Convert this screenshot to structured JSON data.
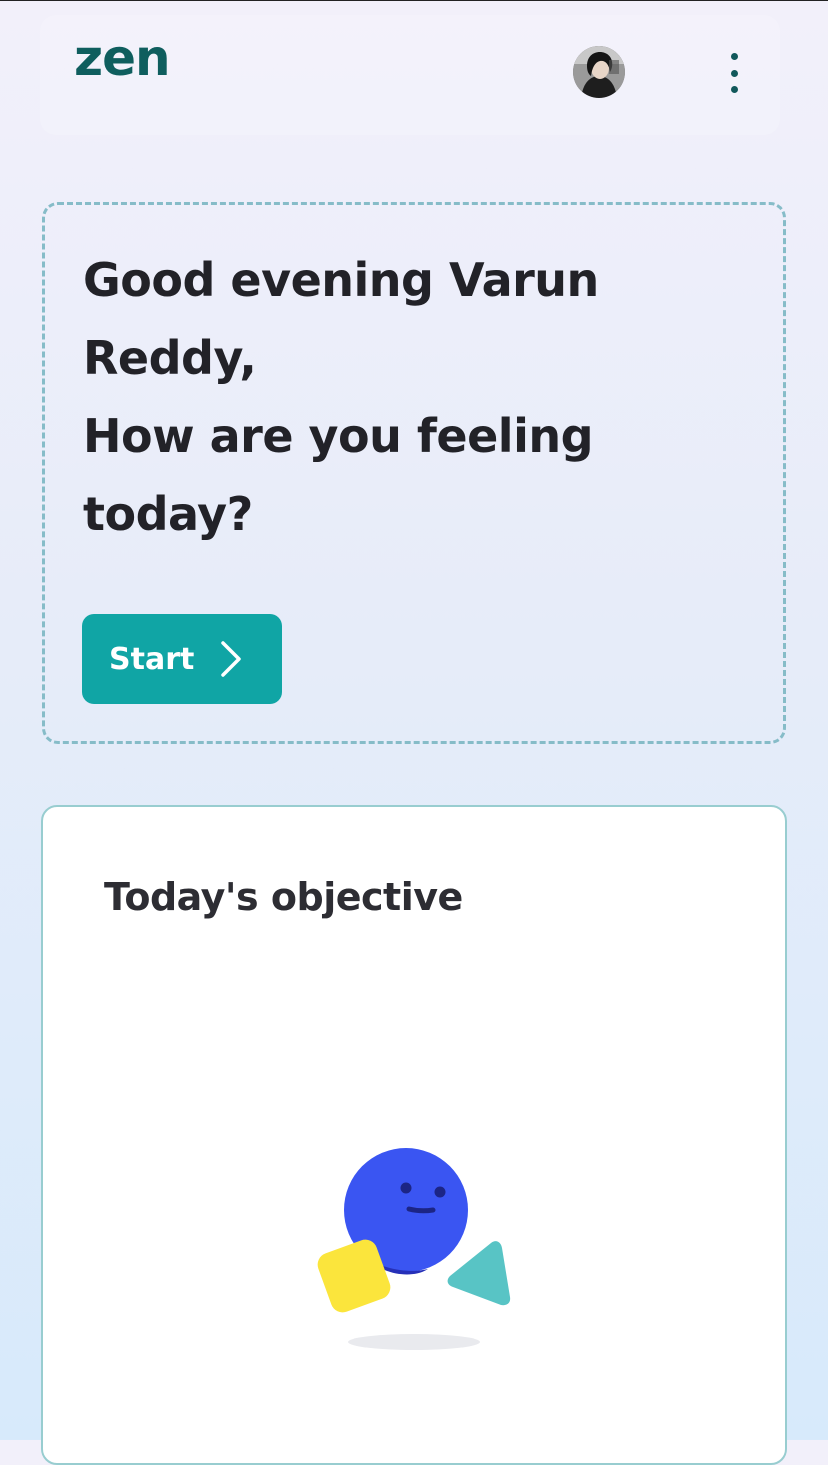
{
  "header": {
    "logo_text": "zen",
    "avatar_icon": "user-avatar",
    "menu_icon": "kebab-menu-icon"
  },
  "greeting": {
    "line1": "Good evening Varun",
    "line2": "Reddy,",
    "line3": "How are you feeling",
    "line4": "today?",
    "start_label": "Start",
    "start_icon": "chevron-right-icon"
  },
  "objective": {
    "title": "Today's objective",
    "illustration_icon": "shapes-mascot-illustration"
  },
  "colors": {
    "brand": "#0f5e5e",
    "accent": "#10a5a5",
    "card_border": "#86bcc8"
  }
}
